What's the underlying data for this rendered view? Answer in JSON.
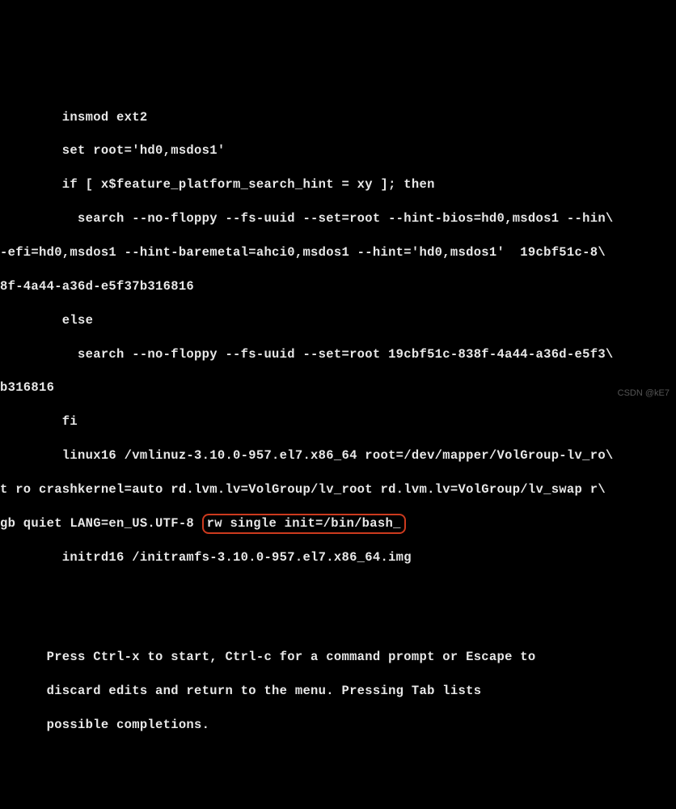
{
  "grub": {
    "l1": "        insmod ext2",
    "l2": "        set root='hd0,msdos1'",
    "l3": "        if [ x$feature_platform_search_hint = xy ]; then",
    "l4": "          search --no-floppy --fs-uuid --set=root --hint-bios=hd0,msdos1 --hin\\",
    "l5": "-efi=hd0,msdos1 --hint-baremetal=ahci0,msdos1 --hint='hd0,msdos1'  19cbf51c-8\\",
    "l6": "8f-4a44-a36d-e5f37b316816",
    "l7": "        else",
    "l8": "          search --no-floppy --fs-uuid --set=root 19cbf51c-838f-4a44-a36d-e5f3\\",
    "l9": "b316816",
    "l10": "        fi",
    "l11": "        linux16 /vmlinuz-3.10.0-957.el7.x86_64 root=/dev/mapper/VolGroup-lv_ro\\",
    "l12": "t ro crashkernel=auto rd.lvm.lv=VolGroup/lv_root rd.lvm.lv=VolGroup/lv_swap r\\",
    "l13a": "gb quiet LANG=en_US.UTF-8 ",
    "l13b": "rw single init=/bin/bash_",
    "l14": "        initrd16 /initramfs-3.10.0-957.el7.x86_64.img"
  },
  "help": {
    "h1": "      Press Ctrl-x to start, Ctrl-c for a command prompt or Escape to",
    "h2": "      discard edits and return to the menu. Pressing Tab lists",
    "h3": "      possible completions."
  },
  "watermark": "CSDN @kE7"
}
